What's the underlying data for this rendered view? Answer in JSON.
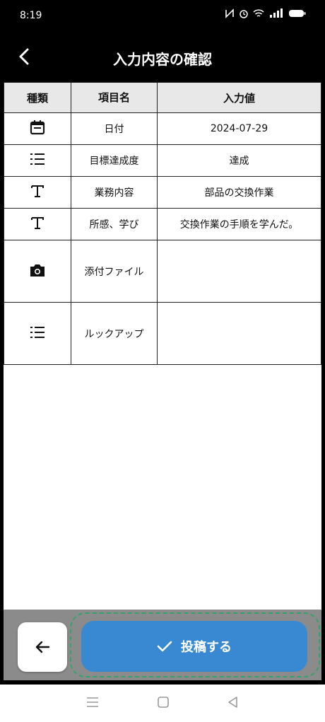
{
  "status": {
    "time": "8:19"
  },
  "header": {
    "title": "入力内容の確認"
  },
  "table": {
    "headers": [
      "種類",
      "項目名",
      "入力値"
    ],
    "rows": [
      {
        "icon": "calendar-icon",
        "name": "日付",
        "value": "2024-07-29"
      },
      {
        "icon": "list-icon",
        "name": "目標達成度",
        "value": "達成"
      },
      {
        "icon": "text-icon",
        "name": "業務内容",
        "value": "部品の交換作業"
      },
      {
        "icon": "text-icon",
        "name": "所感、学び",
        "value": "交換作業の手順を学んだ。"
      },
      {
        "icon": "camera-icon",
        "name": "添付ファイル",
        "value": ""
      },
      {
        "icon": "list-icon",
        "name": "ルックアップ",
        "value": ""
      }
    ]
  },
  "footer": {
    "submit_label": "投稿する"
  },
  "colors": {
    "accent": "#3889d1",
    "header_bg": "#000000",
    "footer_bg": "#8b8b8b"
  }
}
